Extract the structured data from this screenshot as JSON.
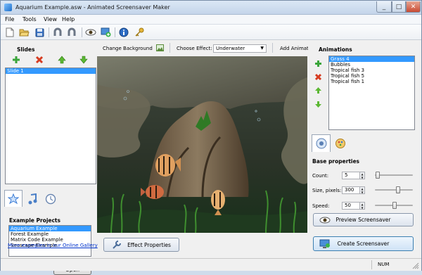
{
  "window": {
    "title": "Aquarium Example.asw - Animated Screensaver Maker"
  },
  "menu": [
    "File",
    "Tools",
    "View",
    "Help"
  ],
  "toolbar_icons": [
    "new-icon",
    "open-icon",
    "save-icon",
    "undo-icon",
    "redo-icon",
    "preview-eye-icon",
    "add-slide-icon",
    "info-icon",
    "key-icon"
  ],
  "slides": {
    "heading": "Slides",
    "items": [
      "Slide 1"
    ]
  },
  "example_projects": {
    "heading": "Example Projects",
    "items": [
      "Aquarium Example",
      "Forest Example",
      "Matrix Code Example",
      "Seascape Example"
    ],
    "selected": 0,
    "open_label": "Open",
    "gallery_link": "More examples in our Online Gallery"
  },
  "top_controls": {
    "change_background": "Change Background",
    "choose_effect_label": "Choose Effect:",
    "effect_value": "Underwater",
    "add_animation": "Add Animati"
  },
  "effect_properties_label": "Effect Properties",
  "animations": {
    "heading": "Animations",
    "items": [
      "Grass 4",
      "Bubbles",
      "Tropical fish 3",
      "Tropical fish 5",
      "Tropical fish 1"
    ],
    "selected": 0
  },
  "base_properties": {
    "heading": "Base properties",
    "count_label": "Count:",
    "count_value": "5",
    "count_level": 0.05,
    "size_label": "Size, pixels:",
    "size_value": "300",
    "size_level": 0.6,
    "speed_label": "Speed:",
    "speed_value": "50",
    "speed_level": 0.5
  },
  "preview_label": "Preview Screensaver",
  "create_label": "Create Screensaver",
  "status": {
    "num": "NUM"
  },
  "colors": {
    "accent": "#3399ff",
    "link": "#0033cc"
  }
}
